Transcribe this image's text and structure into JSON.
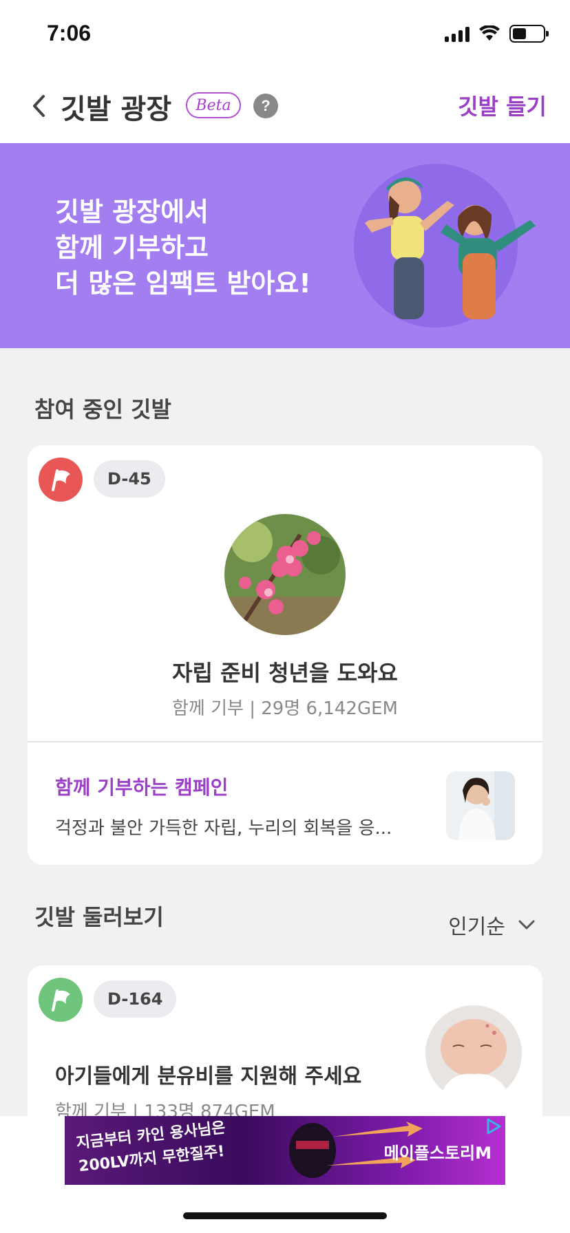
{
  "status": {
    "time": "7:06"
  },
  "nav": {
    "title": "깃발 광장",
    "badge": "Beta",
    "help": "?",
    "action": "깃발 들기"
  },
  "hero": {
    "line1": "깃발 광장에서",
    "line2": "함께 기부하고",
    "line3": "더 많은 임팩트 받아요!"
  },
  "joined": {
    "section_title": "참여 중인 깃발",
    "dday": "D-45",
    "campaign_title": "자립 준비 청년을 도와요",
    "meta": "함께 기부 | 29명   6,142GEM",
    "linked_title": "함께 기부하는 캠페인",
    "linked_desc": "걱정과 불안 가득한 자립, 누리의 회복을 응..."
  },
  "browse": {
    "section_title": "깃발 둘러보기",
    "sort_label": "인기순",
    "items": [
      {
        "dday": "D-164",
        "title": "아기들에게 분유비를 지원해 주세요",
        "meta": "함께 기부 | 133명   874GEM"
      }
    ]
  },
  "ad": {
    "line1": "지금부터 카인 용사님은",
    "line2": "200LV까지 무한질주!",
    "brand": "메이플스토리M"
  },
  "colors": {
    "accent": "#9b3fc6",
    "hero_bg": "#a27ef0",
    "flag_red": "#e95656",
    "flag_green": "#6fc57c"
  },
  "icons": [
    "back-chevron-icon",
    "help-icon",
    "flag-icon",
    "chevron-down-icon",
    "wifi-icon",
    "signal-icon",
    "battery-icon",
    "ad-choices-icon"
  ]
}
